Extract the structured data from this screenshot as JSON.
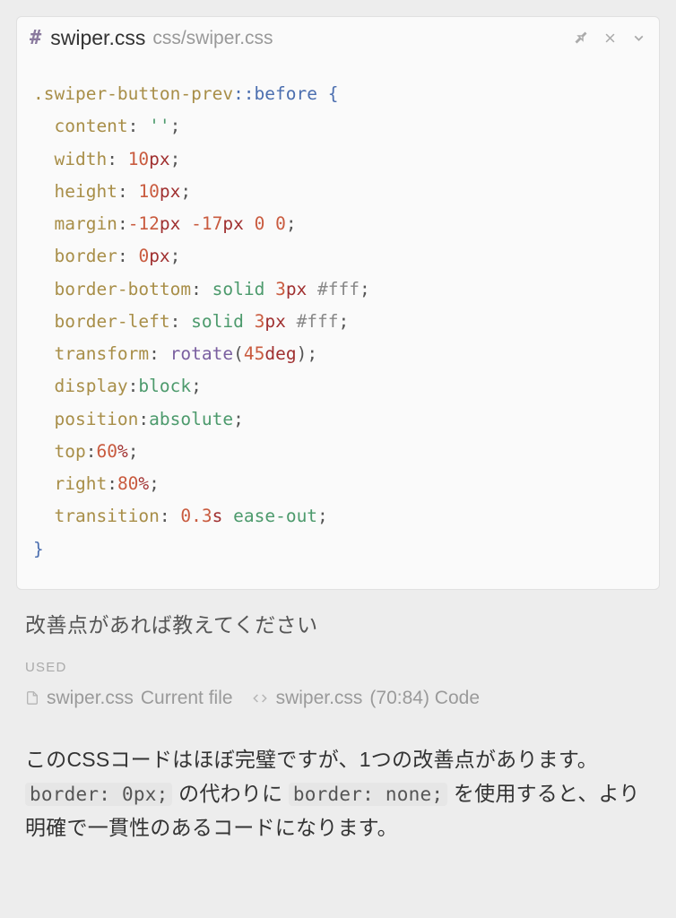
{
  "header": {
    "hash": "#",
    "filename": "swiper.css",
    "filepath": "css/swiper.css"
  },
  "code": {
    "selector": ".swiper-button-prev",
    "pseudo": "::before",
    "open": "{",
    "close": "}",
    "props": {
      "content_k": "content",
      "content_v": "''",
      "width_k": "width",
      "width_n": "10",
      "width_u": "px",
      "height_k": "height",
      "height_n": "10",
      "height_u": "px",
      "margin_k": "margin",
      "margin_n1": "-12",
      "margin_u1": "px",
      "margin_n2": "-17",
      "margin_u2": "px",
      "margin_n3": "0",
      "margin_n4": "0",
      "border_k": "border",
      "border_n": "0",
      "border_u": "px",
      "bb_k": "border-bottom",
      "bb_solid": "solid",
      "bb_n": "3",
      "bb_u": "px",
      "bb_hex": "#fff",
      "bl_k": "border-left",
      "bl_solid": "solid",
      "bl_n": "3",
      "bl_u": "px",
      "bl_hex": "#fff",
      "transform_k": "transform",
      "transform_fn": "rotate",
      "transform_n": "45",
      "transform_u": "deg",
      "display_k": "display",
      "display_v": "block",
      "position_k": "position",
      "position_v": "absolute",
      "top_k": "top",
      "top_n": "60",
      "top_u": "%",
      "right_k": "right",
      "right_n": "80",
      "right_u": "%",
      "transition_k": "transition",
      "transition_n": "0.3",
      "transition_u": "s",
      "transition_ease": "ease-out"
    }
  },
  "prompt": "改善点があれば教えてください",
  "used": {
    "label": "USED",
    "items": [
      {
        "filename": "swiper.css",
        "detail": "Current file",
        "kind": "file"
      },
      {
        "filename": "swiper.css",
        "detail": "(70:84) Code",
        "kind": "code"
      }
    ]
  },
  "response": {
    "t1": "このCSSコードはほぼ完璧ですが、1つの改善点があります。",
    "c1": "border: 0px;",
    "t2": " の代わりに ",
    "c2": "border: none;",
    "t3": " を使用すると、より明確で一貫性のあるコードになります。"
  }
}
